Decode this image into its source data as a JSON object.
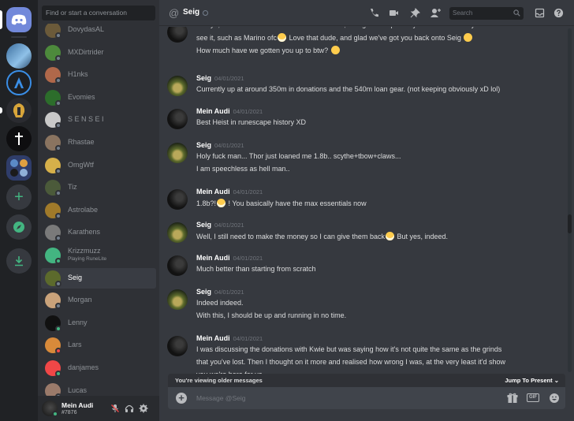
{
  "servers": {
    "home_label": "Home",
    "add_label": "+"
  },
  "dm_sidebar": {
    "search_placeholder": "Find or start a conversation",
    "items": [
      {
        "name": "DovydasAL",
        "status": "offline",
        "avatar_color": "#6b5a3a"
      },
      {
        "name": "MXDirtrider",
        "status": "offline",
        "avatar_color": "#4d8a3c"
      },
      {
        "name": "H1nks",
        "status": "offline",
        "avatar_color": "#b0684a"
      },
      {
        "name": "Evomies",
        "status": "offline",
        "avatar_color": "#2c6d2b"
      },
      {
        "name": "S E N S E I",
        "status": "offline",
        "avatar_color": "#c9c9c9"
      },
      {
        "name": "Rhastae",
        "status": "offline",
        "avatar_color": "#8a7460"
      },
      {
        "name": "OmgWtf",
        "status": "offline",
        "avatar_color": "#d6b04a"
      },
      {
        "name": "Tiz",
        "status": "offline",
        "avatar_color": "#4b5a3a"
      },
      {
        "name": "Astrolabe",
        "status": "offline",
        "avatar_color": "#a07a2a"
      },
      {
        "name": "Karathens",
        "status": "offline",
        "avatar_color": "#7a7a7a"
      },
      {
        "name": "Krizzmuzz",
        "status": "online",
        "avatar_color": "#43b581",
        "activity": "Playing RuneLite"
      },
      {
        "name": "Seig",
        "status": "offline",
        "avatar_color": "#5c6a2c"
      },
      {
        "name": "Morgan",
        "status": "offline",
        "avatar_color": "#c9a27a"
      },
      {
        "name": "Lenny",
        "status": "online",
        "avatar_color": "#111111"
      },
      {
        "name": "Lars",
        "status": "dnd",
        "avatar_color": "#d88a3a"
      },
      {
        "name": "danjames",
        "status": "online",
        "avatar_color": "#f04747"
      },
      {
        "name": "Lucas",
        "status": "offline",
        "avatar_color": "#9a7a6a"
      }
    ]
  },
  "user": {
    "name": "Mein Audi",
    "tag": "#7876"
  },
  "header": {
    "at_symbol": "@",
    "channel_name": "Seig",
    "search_placeholder": "Search"
  },
  "messages": [
    {
      "author": "",
      "timestamp": "",
      "avatar": "audi",
      "lines": [
        "Hell ye, send it dude! Do it as a soft notification, or tag those specific you would definitely want to",
        "see it, such as Marino ofc  Love that dude, and glad we've got you back onto Seig ",
        "How much have we gotten you up to btw? "
      ]
    },
    {
      "author": "Seig",
      "timestamp": "04/01/2021",
      "avatar": "seig",
      "lines": [
        "Currently up at around 350m in donations and the 540m loan gear. (not keeping obviously xD lol)"
      ]
    },
    {
      "author": "Mein Audi",
      "timestamp": "04/01/2021",
      "avatar": "audi",
      "lines": [
        "Best Heist in runescape history XD"
      ]
    },
    {
      "author": "Seig",
      "timestamp": "04/01/2021",
      "avatar": "seig",
      "lines": [
        "Holy fuck man... Thor just loaned me 1.8b.. scythe+tbow+claws...",
        "I am speechless as hell man.."
      ]
    },
    {
      "author": "Mein Audi",
      "timestamp": "04/01/2021",
      "avatar": "audi",
      "lines": [
        "1.8b?!  ! You basically have the max essentials now"
      ]
    },
    {
      "author": "Seig",
      "timestamp": "04/01/2021",
      "avatar": "seig",
      "lines": [
        "Well, I still need to make the money so I can give them back  But yes, indeed."
      ]
    },
    {
      "author": "Mein Audi",
      "timestamp": "04/01/2021",
      "avatar": "audi",
      "lines": [
        "Much better than starting from scratch"
      ]
    },
    {
      "author": "Seig",
      "timestamp": "04/01/2021",
      "avatar": "seig",
      "lines": [
        "Indeed indeed.",
        "With this, I should be up and running in no time."
      ]
    },
    {
      "author": "Mein Audi",
      "timestamp": "04/01/2021",
      "avatar": "audi",
      "lines": [
        "I was discussing the donations with Kwie but was saying how it's not quite the same as the grinds",
        "that you've lost. Then I thought on it more and realised how wrong I was, at the very least it'd show",
        "you we're here for ya"
      ]
    }
  ],
  "composer": {
    "older_notice": "You're viewing older messages",
    "jump_label": "Jump To Present",
    "placeholder": "Message @Seig",
    "gif_label": "GIF"
  }
}
